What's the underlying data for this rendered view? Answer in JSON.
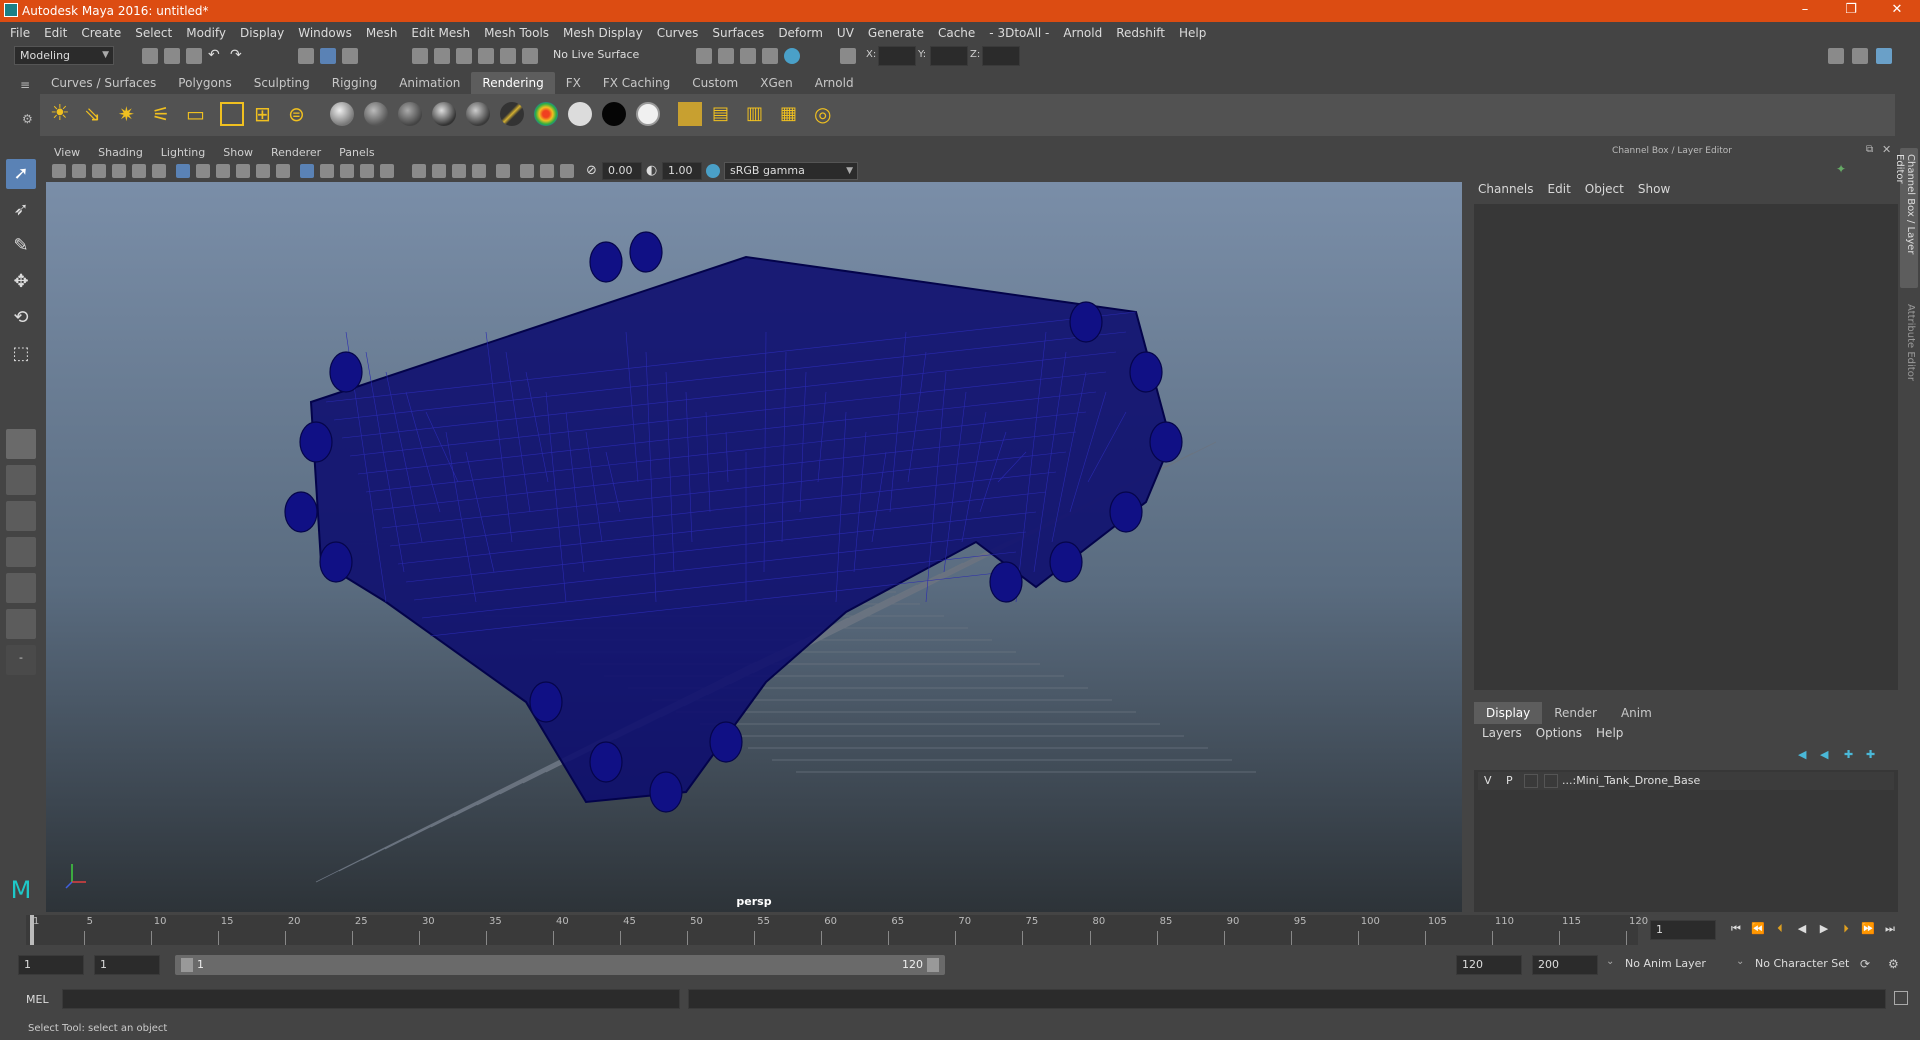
{
  "window": {
    "title": "Autodesk Maya 2016: untitled*",
    "controls": [
      "–",
      "❐",
      "✕"
    ]
  },
  "menus": [
    "File",
    "Edit",
    "Create",
    "Select",
    "Modify",
    "Display",
    "Windows",
    "Mesh",
    "Edit Mesh",
    "Mesh Tools",
    "Mesh Display",
    "Curves",
    "Surfaces",
    "Deform",
    "UV",
    "Generate",
    "Cache",
    "- 3DtoAll -",
    "Arnold",
    "Redshift",
    "Help"
  ],
  "status_line": {
    "mode": "Modeling",
    "live_surface": "No Live Surface",
    "x_label": "X:",
    "y_label": "Y:",
    "z_label": "Z:"
  },
  "shelf_tabs": [
    {
      "label": "Curves / Surfaces",
      "active": false
    },
    {
      "label": "Polygons",
      "active": false
    },
    {
      "label": "Sculpting",
      "active": false
    },
    {
      "label": "Rigging",
      "active": false
    },
    {
      "label": "Animation",
      "active": false
    },
    {
      "label": "Rendering",
      "active": true
    },
    {
      "label": "FX",
      "active": false
    },
    {
      "label": "FX Caching",
      "active": false
    },
    {
      "label": "Custom",
      "active": false
    },
    {
      "label": "XGen",
      "active": false
    },
    {
      "label": "Arnold",
      "active": false
    }
  ],
  "viewport": {
    "menus": [
      "View",
      "Shading",
      "Lighting",
      "Show",
      "Renderer",
      "Panels"
    ],
    "exposure": "0.00",
    "gamma": "1.00",
    "color_space": "sRGB gamma",
    "camera_label": "persp",
    "object_color": "#0c0c6e"
  },
  "channel_box": {
    "header": "Channel Box / Layer Editor",
    "menus": [
      "Channels",
      "Edit",
      "Object",
      "Show"
    ],
    "side_tabs": [
      "Channel Box / Layer Editor",
      "Attribute Editor"
    ]
  },
  "layer_editor": {
    "tabs": [
      {
        "label": "Display",
        "active": true
      },
      {
        "label": "Render",
        "active": false
      },
      {
        "label": "Anim",
        "active": false
      }
    ],
    "menus": [
      "Layers",
      "Options",
      "Help"
    ],
    "layers": [
      {
        "v": "V",
        "p": "P",
        "name": "...:Mini_Tank_Drone_Base"
      }
    ]
  },
  "timeline": {
    "ticks": [
      "1",
      "5",
      "10",
      "15",
      "20",
      "25",
      "30",
      "35",
      "40",
      "45",
      "50",
      "55",
      "60",
      "65",
      "70",
      "75",
      "80",
      "85",
      "90",
      "95",
      "100",
      "105",
      "110",
      "115",
      "120"
    ],
    "current_frame": "1"
  },
  "range": {
    "start": "1",
    "playback_start": "1",
    "slider_start": "1",
    "slider_end": "120",
    "playback_end": "120",
    "end": "200",
    "anim_layer": "No Anim Layer",
    "character_set": "No Character Set"
  },
  "command_line": {
    "label": "MEL"
  },
  "help_line": {
    "text": "Select Tool: select an object"
  }
}
